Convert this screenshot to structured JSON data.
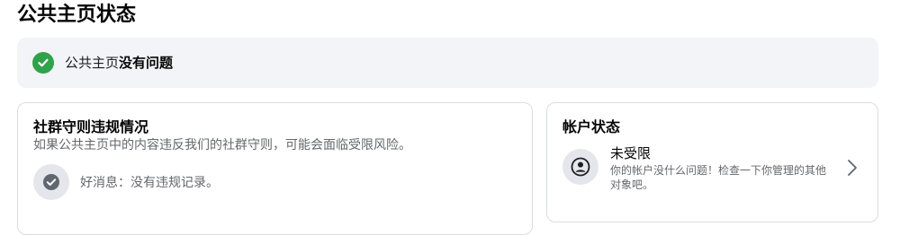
{
  "page": {
    "title": "公共主页状态"
  },
  "banner": {
    "prefix": "公共主页",
    "emphasis": "没有问题",
    "icon": "check-circle-icon",
    "icon_color": "#31a24c"
  },
  "community_card": {
    "heading": "社群守则违规情况",
    "description": "如果公共主页中的内容违反我们的社群守则，可能会面临受限风险。",
    "good_news": "好消息：没有违规记录。",
    "icon": "check-circle-icon"
  },
  "account_card": {
    "heading": "帐户状态",
    "status": "未受限",
    "description": "你的帐户没什么问题！检查一下你管理的其他对象吧。",
    "icon": "user-icon",
    "action_icon": "chevron-right-icon"
  },
  "colors": {
    "banner_bg": "#f2f4f7",
    "border": "#dadde1",
    "secondary_text": "#65676b",
    "success": "#31a24c"
  }
}
